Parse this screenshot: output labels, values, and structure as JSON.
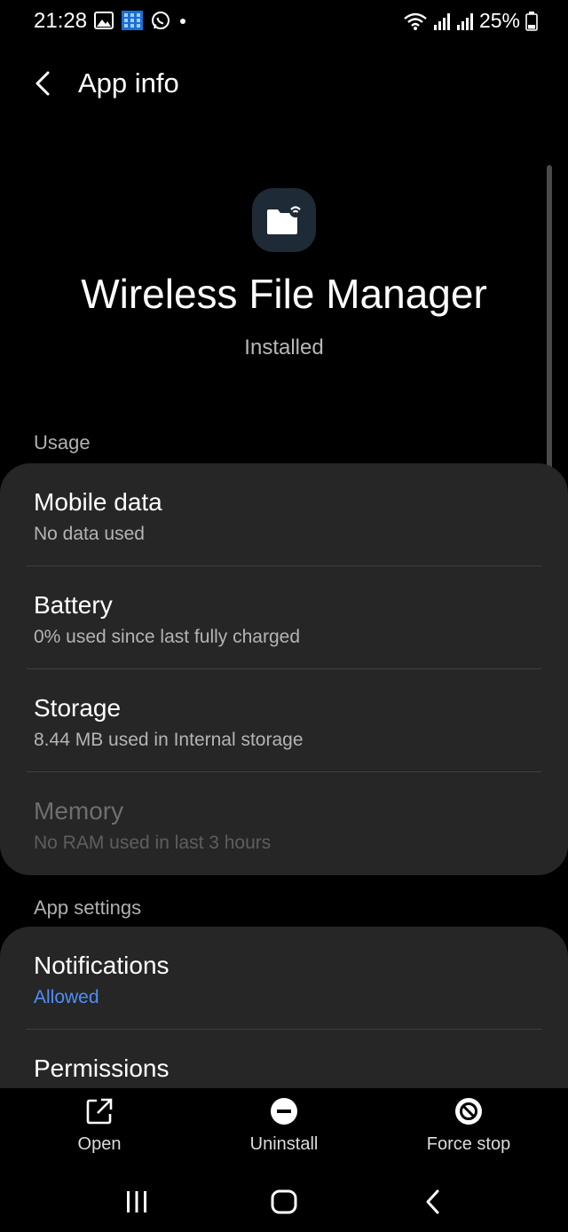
{
  "status_bar": {
    "time": "21:28",
    "battery_percent": "25%",
    "icons": [
      "gallery-icon",
      "app-grid-icon",
      "whatsapp-icon",
      "dot-icon",
      "wifi-icon",
      "signal-icon",
      "signal-icon",
      "battery-icon"
    ]
  },
  "header": {
    "title": "App info"
  },
  "app": {
    "name": "Wireless File Manager",
    "status": "Installed",
    "icon": "folder-wireless-icon"
  },
  "usage": {
    "label": "Usage",
    "items": [
      {
        "title": "Mobile data",
        "subtitle": "No data used"
      },
      {
        "title": "Battery",
        "subtitle": "0% used since last fully charged"
      },
      {
        "title": "Storage",
        "subtitle": "8.44 MB used in Internal storage"
      },
      {
        "title": "Memory",
        "subtitle": "No RAM used in last 3 hours"
      }
    ]
  },
  "app_settings": {
    "label": "App settings",
    "items": [
      {
        "title": "Notifications",
        "subtitle": "Allowed"
      },
      {
        "title": "Permissions"
      }
    ]
  },
  "actions": {
    "open": "Open",
    "uninstall": "Uninstall",
    "force_stop": "Force stop"
  },
  "colors": {
    "background": "#000000",
    "card": "#262626",
    "accent": "#4f8ef7",
    "secondary_text": "#b4b4b4",
    "disabled_text": "#6e6e6e"
  }
}
